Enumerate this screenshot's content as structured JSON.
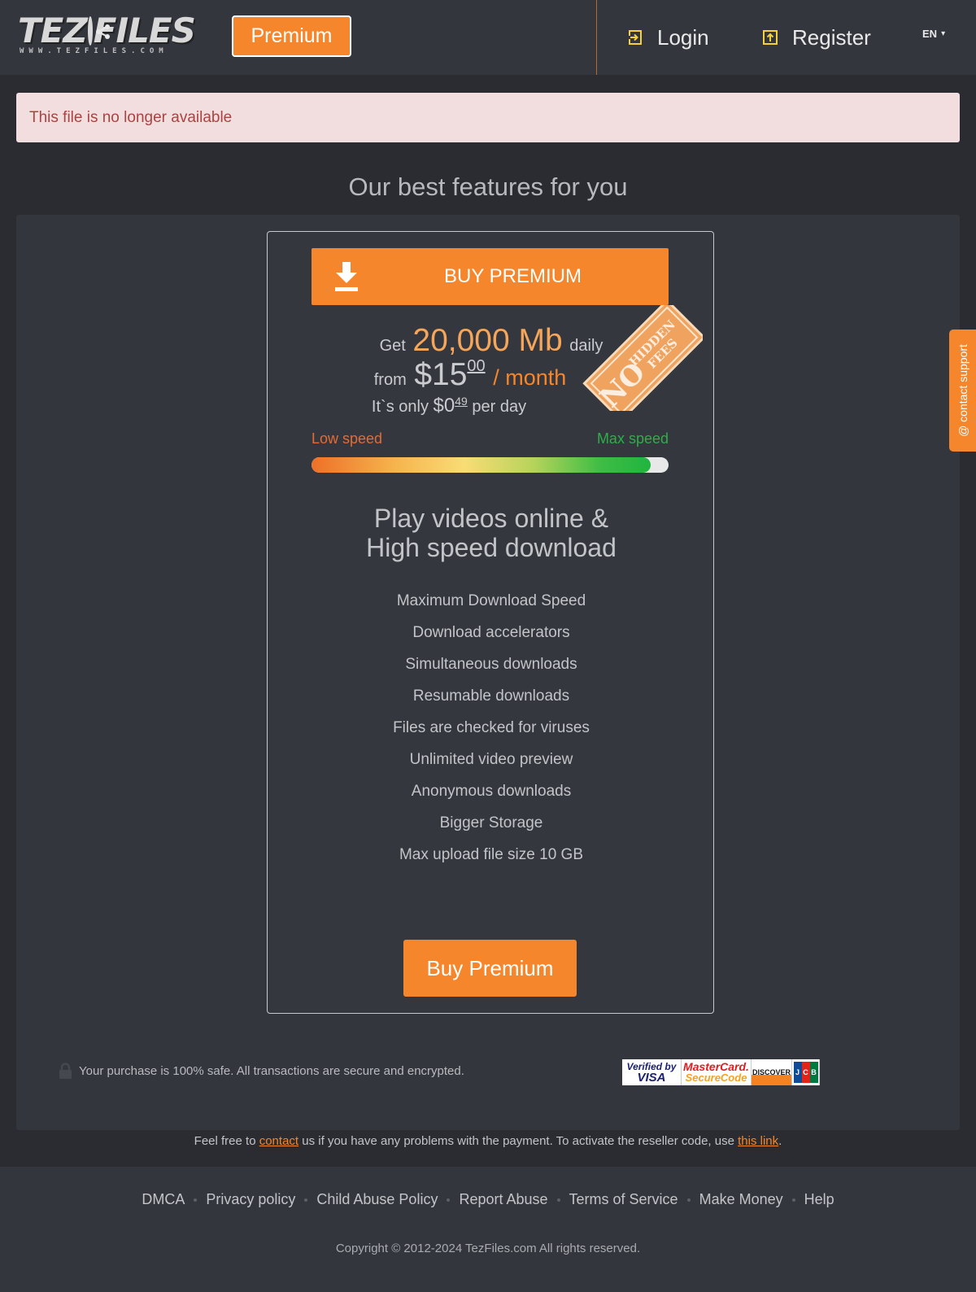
{
  "header": {
    "logo_text_left": "TEZ",
    "logo_text_right": "FILES",
    "logo_subtext": "WWW.TEZFILES.COM",
    "premium_button": "Premium",
    "login": "Login",
    "register": "Register",
    "language": "EN"
  },
  "alert": {
    "message": "This file is no longer available"
  },
  "section_title": "Our best features for you",
  "offer": {
    "buy_button": "BUY PREMIUM",
    "get_label": "Get",
    "daily_amount": "20,000 Mb",
    "daily_label": "daily",
    "from_label": "from",
    "price_main": "$15",
    "price_cents": "00",
    "price_period": "/ month",
    "per_day_prefix": "It`s only",
    "per_day_main": "$0",
    "per_day_cents": "49",
    "per_day_suffix": "per day",
    "stamp_line1": "NO",
    "stamp_line2": "HIDDEN",
    "stamp_line3": "FEES",
    "speed_low_label": "Low speed",
    "speed_max_label": "Max speed",
    "speed_level": 0.95,
    "play_title_line1": "Play videos online &",
    "play_title_line2": "High speed download",
    "features": [
      "Maximum Download Speed",
      "Download accelerators",
      "Simultaneous downloads",
      "Resumable downloads",
      "Files are checked for viruses",
      "Unlimited video preview",
      "Anonymous downloads",
      "Bigger Storage",
      "Max upload file size 10 GB"
    ],
    "buy_button_bottom": "Buy Premium"
  },
  "secure_note": "Your purchase is 100% safe. All transactions are secure and encrypted.",
  "payment_logos": {
    "visa_line1": "Verified by",
    "visa_line2": "VISA",
    "mc_line1": "MasterCard.",
    "mc_line2": "SecureCode",
    "discover": "DISCOVER",
    "jcb": "JCB"
  },
  "help": {
    "prefix": "Feel free to",
    "contact_link": "contact",
    "middle": "us if you have any problems with the payment. To activate the reseller code, use",
    "this_link": "this link",
    "suffix": "."
  },
  "footer": {
    "links": [
      "DMCA",
      "Privacy policy",
      "Child Abuse Policy",
      "Report Abuse",
      "Terms of Service",
      "Make Money",
      "Help"
    ],
    "copyright": "Copyright © 2012-2024 TezFiles.com All rights reserved."
  },
  "support_tab": "@ contact support",
  "colors": {
    "accent": "#f5862c",
    "background": "#2a2c31",
    "panel": "#33363c",
    "alert_bg": "#f2dede",
    "alert_text": "#a94442"
  }
}
